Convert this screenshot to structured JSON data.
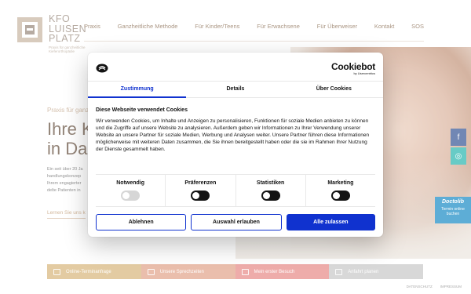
{
  "site": {
    "logo": {
      "line1": "KFO",
      "line2": "LUISEN",
      "line3": "PLATZ",
      "tagline": "Praxis für ganzheitliche Kieferorthopädie"
    },
    "nav": [
      "Praxis",
      "Ganzheitliche Methode",
      "Für Kinder/Teens",
      "Für Erwachsene",
      "Für Überweiser",
      "Kontakt",
      "SOS"
    ],
    "hero": {
      "kicker": "Praxis für ganz",
      "title_line1": "Ihre Ki",
      "title_line2": "in Darr",
      "lead": [
        "Ein seit über 20 Ja",
        "handlungskonzep",
        "Ihrem engagierter",
        "delte Patienten in"
      ],
      "more_link": "Lernen Sie uns k"
    },
    "cta": [
      "Online-Terminanfrage",
      "Unsere Sprechzeiten",
      "Mein erster Besuch",
      "Anfahrt planen"
    ],
    "footer": [
      "DATENSCHUTZ",
      "IMPRESSUM"
    ],
    "social": {
      "facebook": "f",
      "instagram": "◎"
    },
    "doctolib": {
      "brand": "Doctolib",
      "line1": "Termin online",
      "line2": "buchen"
    }
  },
  "cookie": {
    "brand": "Cookiebot",
    "brand_sub": "by Usercentrics",
    "tabs": [
      "Zustimmung",
      "Details",
      "Über Cookies"
    ],
    "active_tab": "Zustimmung",
    "title": "Diese Webseite verwendet Cookies",
    "text": "Wir verwenden Cookies, um Inhalte und Anzeigen zu personalisieren, Funktionen für soziale Medien anbieten zu können und die Zugriffe auf unsere Website zu analysieren. Außerdem geben wir Informationen zu Ihrer Verwendung unserer Website an unsere Partner für soziale Medien, Werbung und Analysen weiter. Unsere Partner führen diese Informationen möglicherweise mit weiteren Daten zusammen, die Sie ihnen bereitgestellt haben oder die sie im Rahmen Ihrer Nutzung der Dienste gesammelt haben.",
    "preferences": [
      {
        "label": "Notwendig",
        "enabled": true,
        "disabled": true
      },
      {
        "label": "Präferenzen",
        "enabled": false
      },
      {
        "label": "Statistiken",
        "enabled": false
      },
      {
        "label": "Marketing",
        "enabled": false
      }
    ],
    "buttons": {
      "deny": "Ablehnen",
      "selection": "Auswahl erlauben",
      "allow_all": "Alle zulassen"
    }
  },
  "colors": {
    "accent": "#1032cf",
    "brand_brown": "#8a6e54"
  }
}
